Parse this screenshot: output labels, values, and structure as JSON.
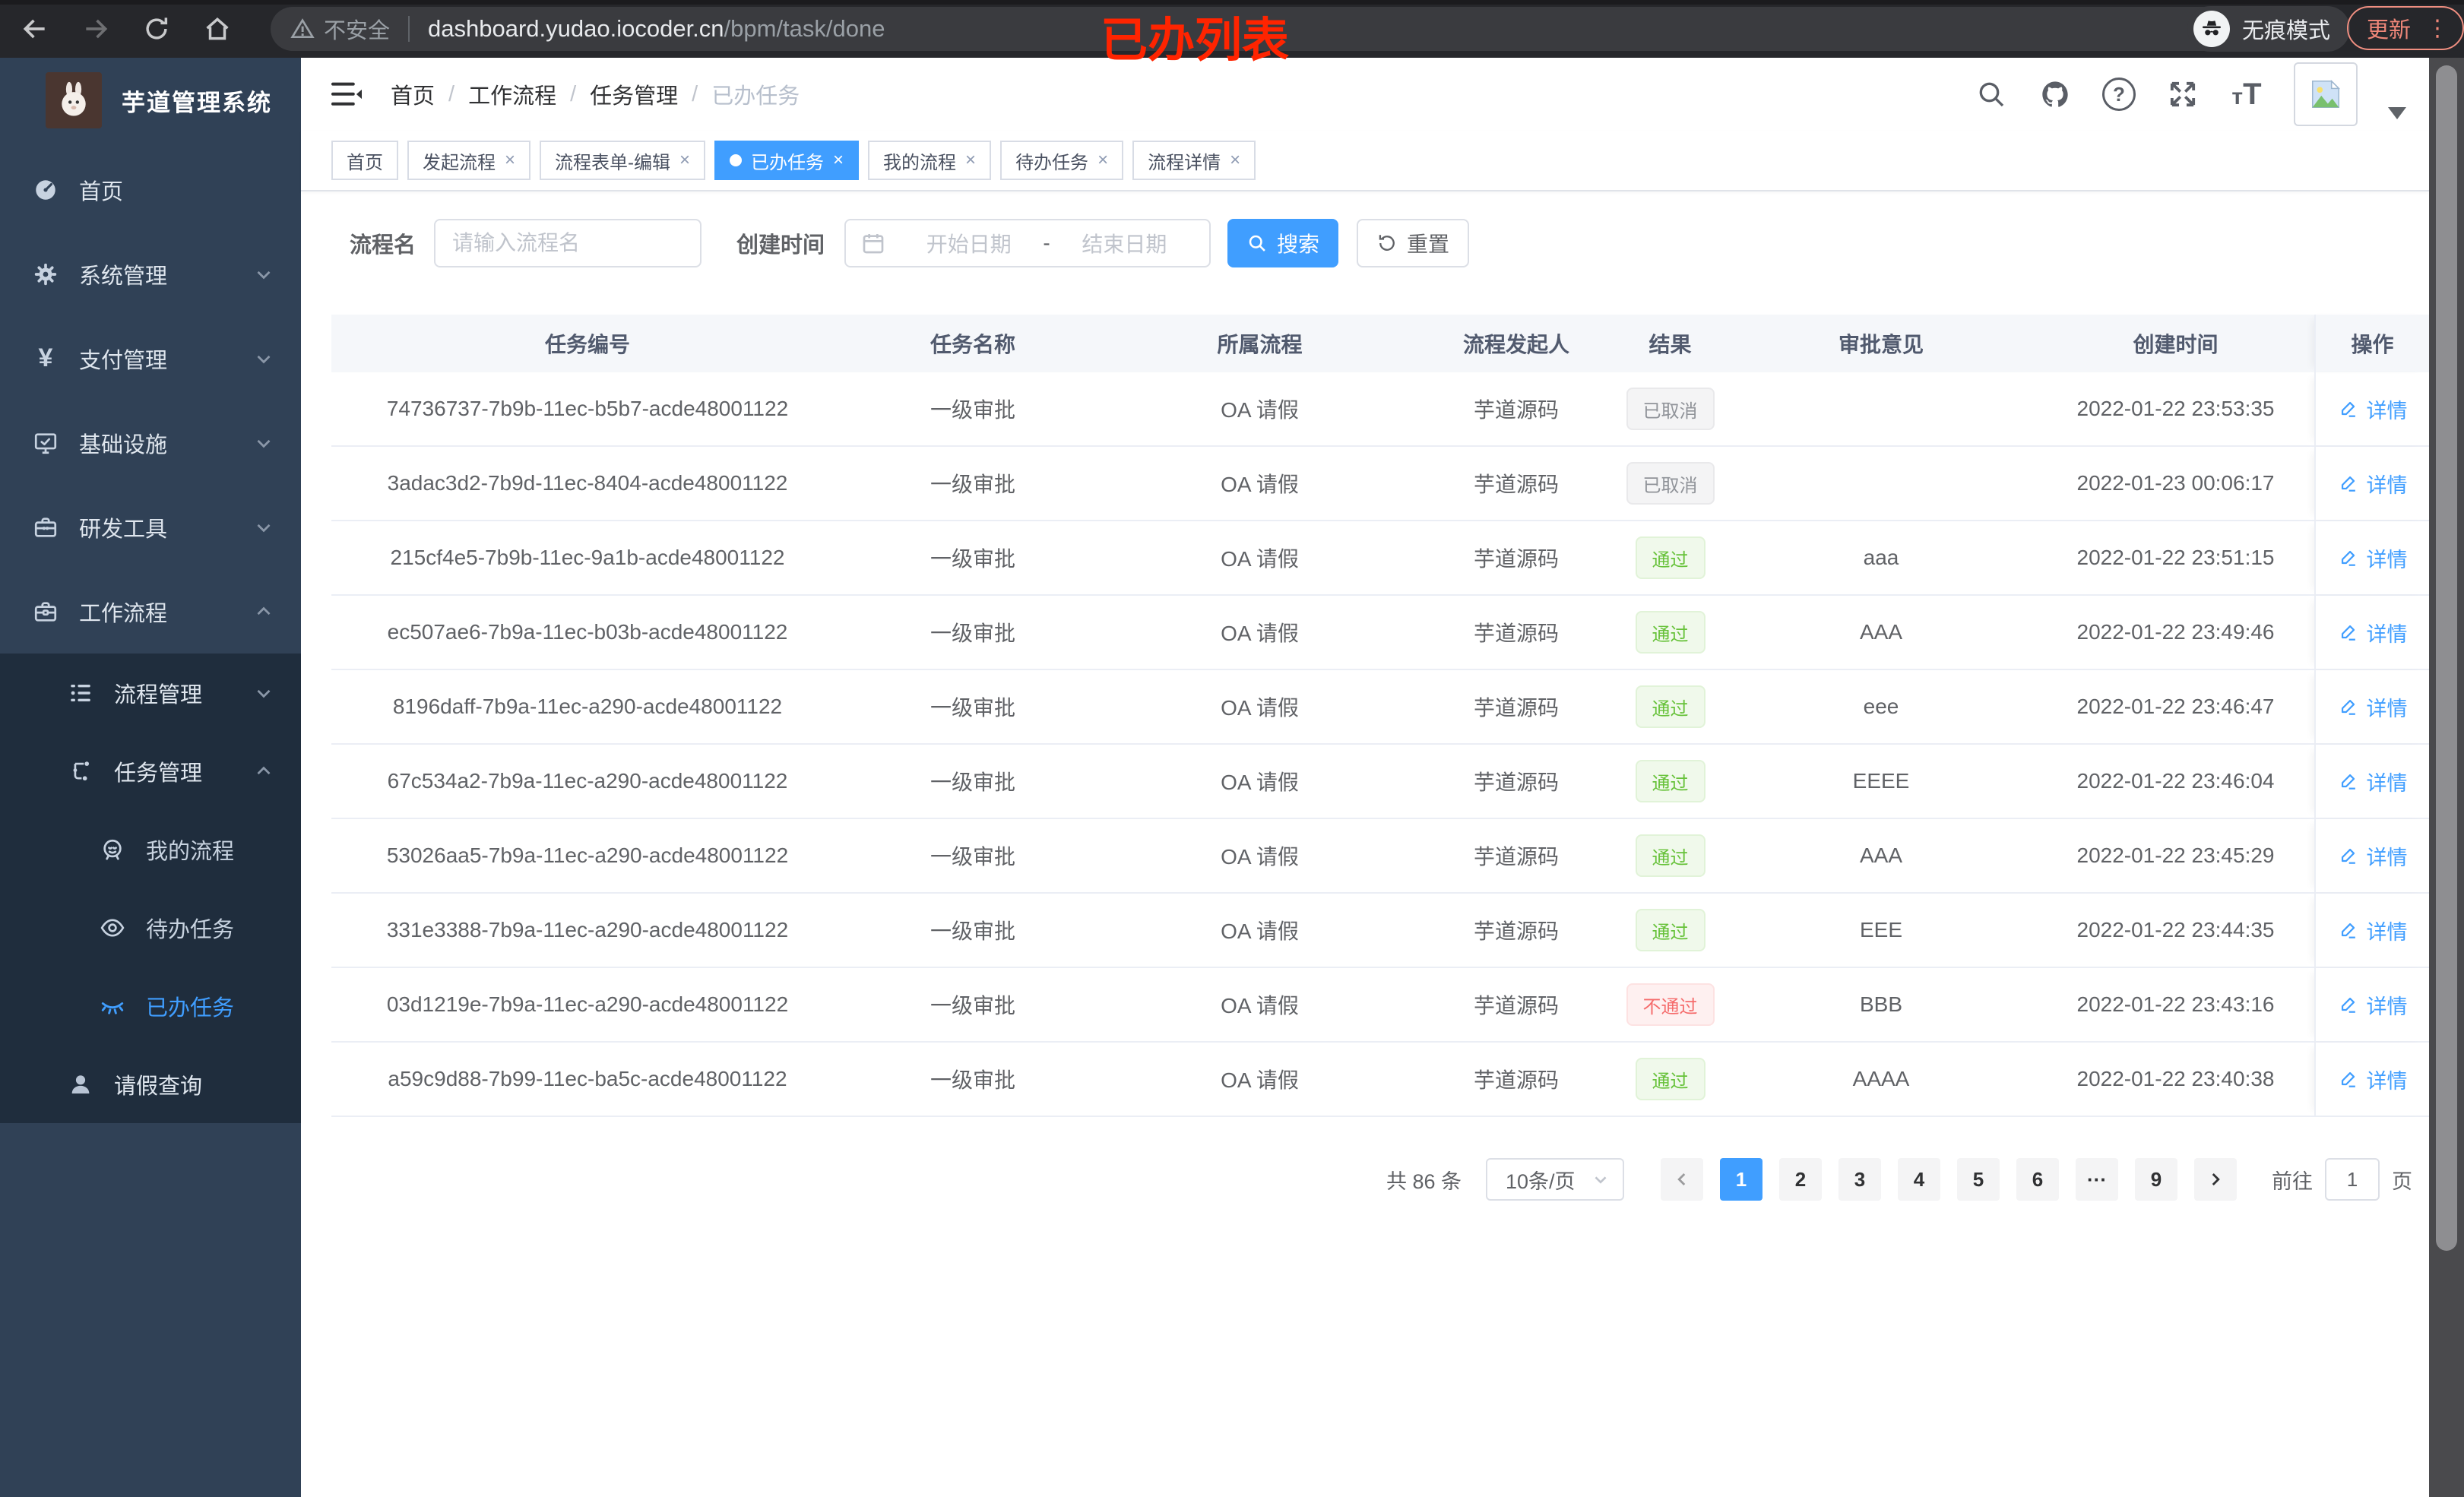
{
  "browser": {
    "security": "不安全",
    "url_host": "dashboard.yudao.iocoder.cn",
    "url_path": "/bpm/task/done",
    "incognito": "无痕模式",
    "update": "更新",
    "annotation": "已办列表"
  },
  "sidebar": {
    "title": "芋道管理系统",
    "menu": [
      {
        "label": "首页",
        "icon": "dashboard-icon",
        "level": 1
      },
      {
        "label": "系统管理",
        "icon": "gear-icon",
        "level": 1,
        "chevron": "down"
      },
      {
        "label": "支付管理",
        "icon": "yen-icon",
        "level": 1,
        "chevron": "down"
      },
      {
        "label": "基础设施",
        "icon": "monitor-icon",
        "level": 1,
        "chevron": "down"
      },
      {
        "label": "研发工具",
        "icon": "toolbox-icon",
        "level": 1,
        "chevron": "down"
      },
      {
        "label": "工作流程",
        "icon": "workflow-icon",
        "level": 1,
        "chevron": "up"
      },
      {
        "label": "流程管理",
        "icon": "list-tree-icon",
        "level": 2,
        "sub": true,
        "chevron": "down"
      },
      {
        "label": "任务管理",
        "icon": "tree-icon",
        "level": 2,
        "sub": true,
        "chevron": "up"
      },
      {
        "label": "我的流程",
        "icon": "robot-icon",
        "level": 3,
        "sub": true
      },
      {
        "label": "待办任务",
        "icon": "eye-icon",
        "level": 3,
        "sub": true
      },
      {
        "label": "已办任务",
        "icon": "eye-closed-icon",
        "level": 3,
        "sub": true,
        "active": true
      },
      {
        "label": "请假查询",
        "icon": "user-icon",
        "level": 2,
        "sub": true
      }
    ]
  },
  "header": {
    "breadcrumb": [
      "首页",
      "工作流程",
      "任务管理",
      "已办任务"
    ]
  },
  "tabs": [
    {
      "label": "首页",
      "closable": false,
      "active": false
    },
    {
      "label": "发起流程",
      "closable": true,
      "active": false
    },
    {
      "label": "流程表单-编辑",
      "closable": true,
      "active": false
    },
    {
      "label": "已办任务",
      "closable": true,
      "active": true
    },
    {
      "label": "我的流程",
      "closable": true,
      "active": false
    },
    {
      "label": "待办任务",
      "closable": true,
      "active": false
    },
    {
      "label": "流程详情",
      "closable": true,
      "active": false
    }
  ],
  "filters": {
    "name_label": "流程名",
    "name_placeholder": "请输入流程名",
    "time_label": "创建时间",
    "start_placeholder": "开始日期",
    "range_separator": "-",
    "end_placeholder": "结束日期",
    "search_label": "搜索",
    "reset_label": "重置"
  },
  "table": {
    "columns": [
      "任务编号",
      "任务名称",
      "所属流程",
      "流程发起人",
      "结果",
      "审批意见",
      "创建时间",
      "操作"
    ],
    "action_label": "详情",
    "rows": [
      {
        "id": "74736737-7b9b-11ec-b5b7-acde48001122",
        "name": "一级审批",
        "process": "OA 请假",
        "starter": "芋道源码",
        "result": "已取消",
        "type": "info",
        "comment": "",
        "created": "2022-01-22 23:53:35"
      },
      {
        "id": "3adac3d2-7b9d-11ec-8404-acde48001122",
        "name": "一级审批",
        "process": "OA 请假",
        "starter": "芋道源码",
        "result": "已取消",
        "type": "info",
        "comment": "",
        "created": "2022-01-23 00:06:17"
      },
      {
        "id": "215cf4e5-7b9b-11ec-9a1b-acde48001122",
        "name": "一级审批",
        "process": "OA 请假",
        "starter": "芋道源码",
        "result": "通过",
        "type": "success",
        "comment": "aaa",
        "created": "2022-01-22 23:51:15"
      },
      {
        "id": "ec507ae6-7b9a-11ec-b03b-acde48001122",
        "name": "一级审批",
        "process": "OA 请假",
        "starter": "芋道源码",
        "result": "通过",
        "type": "success",
        "comment": "AAA",
        "created": "2022-01-22 23:49:46"
      },
      {
        "id": "8196daff-7b9a-11ec-a290-acde48001122",
        "name": "一级审批",
        "process": "OA 请假",
        "starter": "芋道源码",
        "result": "通过",
        "type": "success",
        "comment": "eee",
        "created": "2022-01-22 23:46:47"
      },
      {
        "id": "67c534a2-7b9a-11ec-a290-acde48001122",
        "name": "一级审批",
        "process": "OA 请假",
        "starter": "芋道源码",
        "result": "通过",
        "type": "success",
        "comment": "EEEE",
        "created": "2022-01-22 23:46:04"
      },
      {
        "id": "53026aa5-7b9a-11ec-a290-acde48001122",
        "name": "一级审批",
        "process": "OA 请假",
        "starter": "芋道源码",
        "result": "通过",
        "type": "success",
        "comment": "AAA",
        "created": "2022-01-22 23:45:29"
      },
      {
        "id": "331e3388-7b9a-11ec-a290-acde48001122",
        "name": "一级审批",
        "process": "OA 请假",
        "starter": "芋道源码",
        "result": "通过",
        "type": "success",
        "comment": "EEE",
        "created": "2022-01-22 23:44:35"
      },
      {
        "id": "03d1219e-7b9a-11ec-a290-acde48001122",
        "name": "一级审批",
        "process": "OA 请假",
        "starter": "芋道源码",
        "result": "不通过",
        "type": "danger",
        "comment": "BBB",
        "created": "2022-01-22 23:43:16"
      },
      {
        "id": "a59c9d88-7b99-11ec-ba5c-acde48001122",
        "name": "一级审批",
        "process": "OA 请假",
        "starter": "芋道源码",
        "result": "通过",
        "type": "success",
        "comment": "AAAA",
        "created": "2022-01-22 23:40:38"
      }
    ]
  },
  "pagination": {
    "total": "共 86 条",
    "page_size": "10条/页",
    "pages": [
      "1",
      "2",
      "3",
      "4",
      "5",
      "6",
      "···",
      "9"
    ],
    "active": "1",
    "goto": "前往",
    "goto_value": "1",
    "unit": "页"
  },
  "colors": {
    "accent": "#409eff",
    "success": "#67c23a",
    "danger": "#f56c6c",
    "info": "#909399",
    "sidebar_bg": "#304156",
    "submenu_bg": "#1f2d3d",
    "annotation_red": "#ff2400"
  }
}
